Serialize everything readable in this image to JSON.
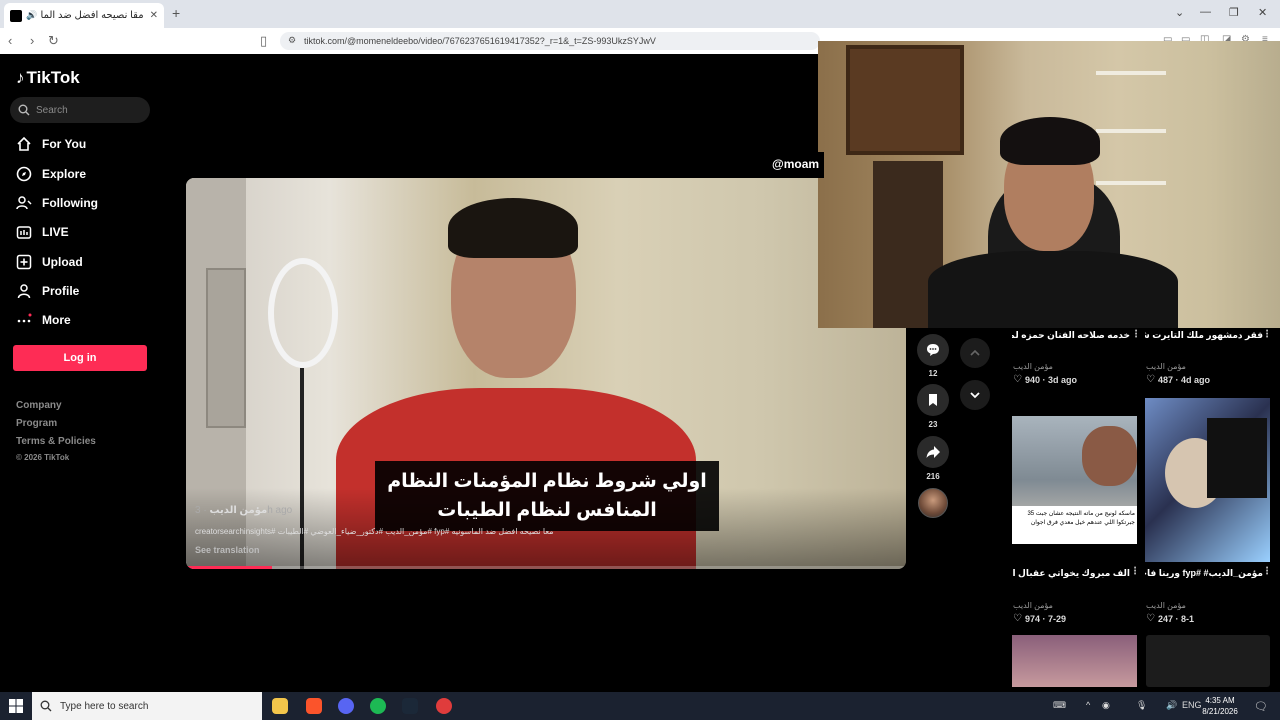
{
  "browser": {
    "tab_title": "مقا نصيحه افضل ضد الماسوث.",
    "url": "tiktok.com/@momeneldeebo/video/7676237651619417352?_r=1&_t=ZS-993UkzSYJwV"
  },
  "sidebar": {
    "logo": "TikTok",
    "search_placeholder": "Search",
    "items": [
      {
        "label": "For You",
        "icon": "home-icon"
      },
      {
        "label": "Explore",
        "icon": "compass-icon"
      },
      {
        "label": "Following",
        "icon": "following-icon"
      },
      {
        "label": "LIVE",
        "icon": "live-icon"
      },
      {
        "label": "Upload",
        "icon": "upload-icon"
      },
      {
        "label": "Profile",
        "icon": "profile-icon"
      },
      {
        "label": "More",
        "icon": "more-icon"
      }
    ],
    "login_label": "Log in",
    "footer": [
      "Company",
      "Program",
      "Terms & Policies"
    ],
    "copyright": "© 2026 TikTok"
  },
  "video": {
    "subtitle": "اولي شروط نظام المؤمنات النظام المنافس لنظام الطيبات",
    "author": "مؤمن الديب",
    "posted": "· 3h ago",
    "caption": "معا نصيحه افضل ضد الماسونيه #fyp #مؤمن_الديب #دكتور_ضياء_العوضي #الطيبات #creatorsearchinsights",
    "see_translation": "See translation",
    "progress": 0.12,
    "handle_tag": "@moam",
    "actions": {
      "comments": "12",
      "saves": "23",
      "shares": "216"
    }
  },
  "related": [
    {
      "title": "خدمه صلاحه الفنان حمزه لمرة بغياته #fyp...",
      "user": "مؤمن الديب",
      "likes": "940",
      "date": "3d ago"
    },
    {
      "title": "فقر دمشهور ملك التايرت شليما #fyp...",
      "user": "مؤمن الديب",
      "likes": "487",
      "date": "4d ago"
    },
    {
      "title": "الف مبروك يخواتي عقبال السيمه ض.ج ذاتكيه #fyp 😊",
      "user": "مؤمن الديب",
      "likes": "974",
      "date": "7-29"
    },
    {
      "title": "مؤمن_الديب# #fyp ورينا فاجر #memes...",
      "user": "مؤمن الديب",
      "likes": "247",
      "date": "8-1"
    }
  ],
  "thumb_caption": "ماسكه لونيج من ماته النتيجه عشان جبت 35 جبرتكوا اللي عندهم خيل معدي فرق اجوان",
  "taskbar": {
    "search_placeholder": "Type here to search",
    "lang": "ENG",
    "time": "4:35 AM",
    "date": "8/21/2026"
  },
  "colors": {
    "accent": "#fe2c55",
    "taskbar": "#1b2230"
  }
}
